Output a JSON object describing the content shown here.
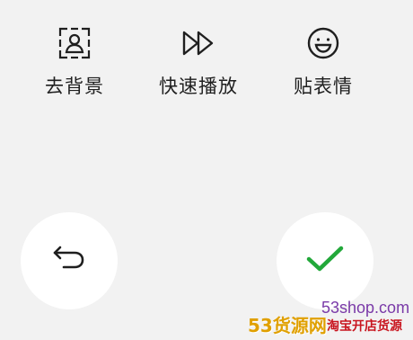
{
  "toolbar": {
    "items": [
      {
        "label": "去背景",
        "icon": "portrait-frame-icon"
      },
      {
        "label": "快速播放",
        "icon": "fast-forward-icon"
      },
      {
        "label": "贴表情",
        "icon": "smiley-icon"
      }
    ]
  },
  "actions": {
    "undo_icon": "undo-icon",
    "confirm_icon": "checkmark-icon",
    "confirm_color": "#22a83a"
  },
  "watermark": {
    "url": "53shop.com",
    "brand": "53货源网",
    "sub": "淘宝开店货源"
  }
}
